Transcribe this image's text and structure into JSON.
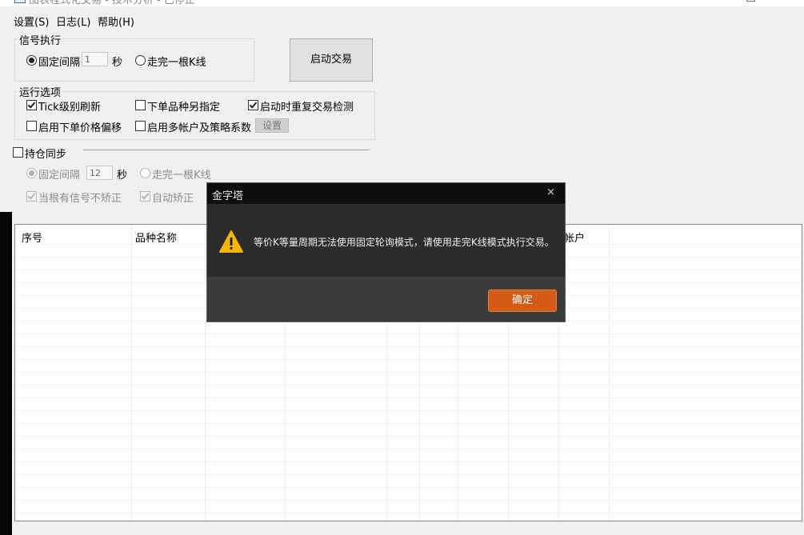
{
  "window": {
    "title": "图表程式化交易 - 技术分析 - 已停止"
  },
  "menu": {
    "items": [
      "设置(S)",
      "日志(L)",
      "帮助(H)"
    ]
  },
  "signal_exec": {
    "title": "信号执行",
    "fixed_interval_label": "固定间隔",
    "interval_value": "1",
    "unit": "秒",
    "walk_bar_label": "走完一根K线"
  },
  "start_button": "启动交易",
  "run_options": {
    "title": "运行选项",
    "tick_refresh": "Tick级别刷新",
    "other_symbol": "下单品种另指定",
    "recheck_on_start": "启动时重复交易检测",
    "price_offset": "启用下单价格偏移",
    "multi_account": "启用多帐户及策略系数",
    "settings_button": "设置"
  },
  "position_sync": {
    "title": "持仓同步",
    "fixed_interval_label": "固定间隔",
    "interval_value": "12",
    "unit": "秒",
    "walk_bar_label": "走完一根K线",
    "only_signal_label": "当根有信号不矫正",
    "auto_correct_label": "自动矫正"
  },
  "table": {
    "columns": [
      "序号",
      "品种名称",
      "帐户"
    ]
  },
  "dialog": {
    "title": "金字塔",
    "close_glyph": "×",
    "message": "等价K等量周期无法使用固定轮询模式，请使用走完K线模式执行交易。",
    "ok_button": "确定"
  },
  "colors": {
    "accent_button": "#d45a17",
    "dialog_bg": "#2c2c2c",
    "warning_icon": "#f5b400"
  }
}
